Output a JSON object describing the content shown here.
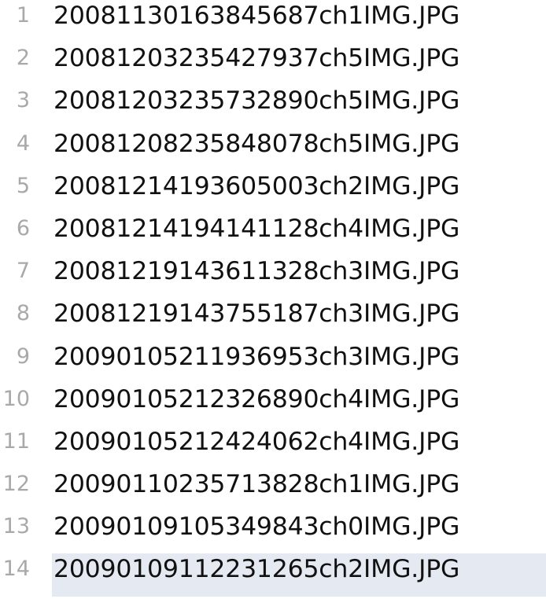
{
  "editor": {
    "lines": [
      {
        "number": "1",
        "text": "20081130163845687ch1IMG.JPG"
      },
      {
        "number": "2",
        "text": "20081203235427937ch5IMG.JPG"
      },
      {
        "number": "3",
        "text": "20081203235732890ch5IMG.JPG"
      },
      {
        "number": "4",
        "text": "20081208235848078ch5IMG.JPG"
      },
      {
        "number": "5",
        "text": "20081214193605003ch2IMG.JPG"
      },
      {
        "number": "6",
        "text": "20081214194141128ch4IMG.JPG"
      },
      {
        "number": "7",
        "text": "20081219143611328ch3IMG.JPG"
      },
      {
        "number": "8",
        "text": "20081219143755187ch3IMG.JPG"
      },
      {
        "number": "9",
        "text": "20090105211936953ch3IMG.JPG"
      },
      {
        "number": "10",
        "text": "20090105212326890ch4IMG.JPG"
      },
      {
        "number": "11",
        "text": "20090105212424062ch4IMG.JPG"
      },
      {
        "number": "12",
        "text": "20090110235713828ch1IMG.JPG"
      },
      {
        "number": "13",
        "text": "20090109105349843ch0IMG.JPG"
      },
      {
        "number": "14",
        "text": "20090109112231265ch2IMG.JPG"
      }
    ],
    "current_line": "14",
    "colors": {
      "line_number": "#a9a9a9",
      "text": "#111111",
      "current_line_highlight": "#e4e9f2",
      "background": "#ffffff"
    }
  }
}
